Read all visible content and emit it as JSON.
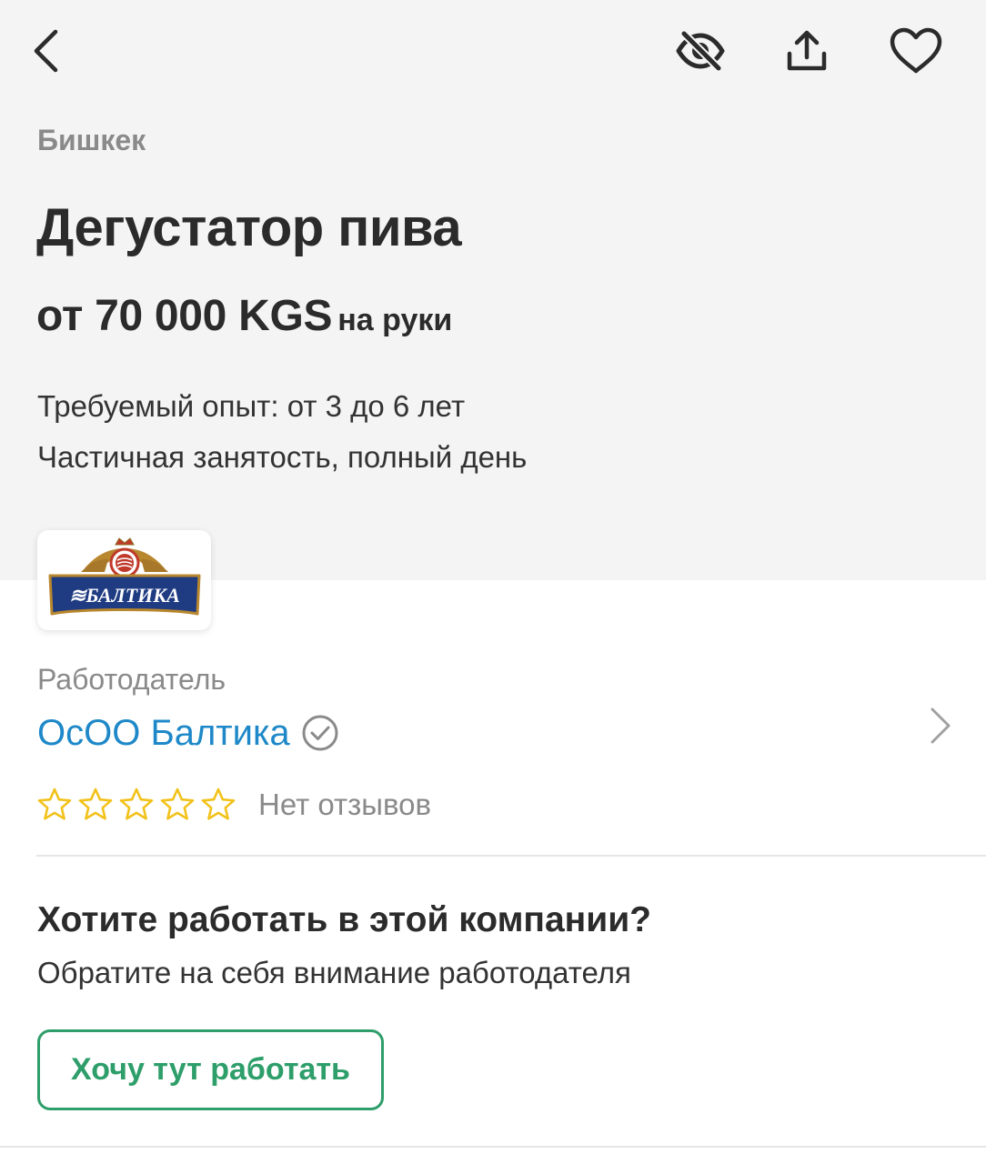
{
  "header": {
    "back_icon": "chevron-left-icon",
    "actions": [
      "eye-off-icon",
      "share-icon",
      "heart-outline-icon"
    ]
  },
  "vacancy": {
    "city": "Бишкек",
    "title": "Дегустатор пива",
    "salary_amount": "от 70 000 KGS",
    "salary_suffix": "на руки",
    "experience": "Требуемый опыт: от 3 до 6 лет",
    "employment": "Частичная занятость, полный день"
  },
  "employer": {
    "logo_text": "≋БАЛТИКА",
    "label": "Работодатель",
    "name": "ОсОО Балтика",
    "verified_icon": "check-circle-icon",
    "rating_stars": 0,
    "rating_max": 5,
    "reviews_text": "Нет отзывов"
  },
  "cta": {
    "title": "Хотите работать в этой компании?",
    "subtitle": "Обратите на себя внимание работодателя",
    "button_label": "Хочу тут работать"
  },
  "colors": {
    "accent_link": "#1e88c8",
    "accent_green": "#2e9e6a",
    "star": "#f2c21b",
    "header_bg": "#f4f4f4"
  }
}
